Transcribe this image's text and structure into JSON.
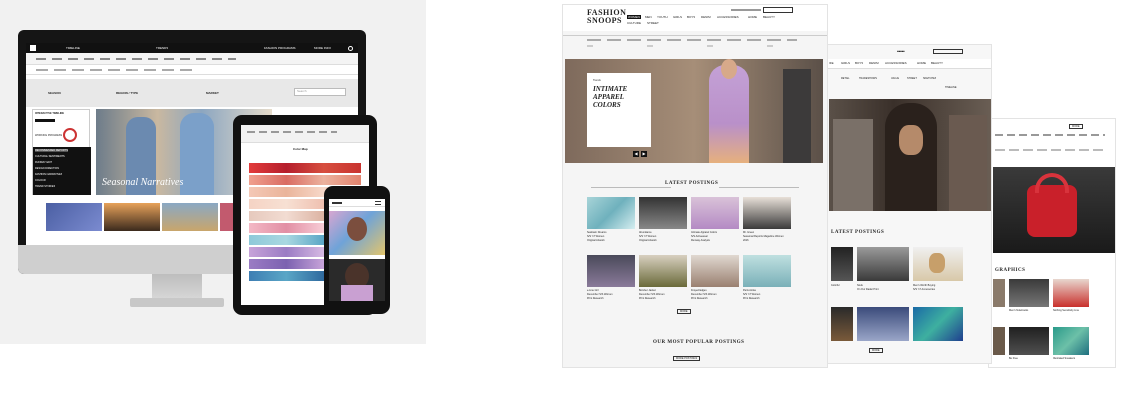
{
  "monitor": {
    "tabs": [
      "TIMELINE",
      "TRENDS"
    ],
    "top_right": [
      "FASHION PROGRAMS",
      "MORE INFO"
    ],
    "filters": [
      "SEASON",
      "REGION / TYPE",
      "MARKET"
    ],
    "search_placeholder": "Search",
    "sidebar": {
      "title": "INTERACTIVE TIMELINE",
      "label": "WORKING PROGRESS",
      "items": [
        "RECOMMENDED REPORTS",
        "CULTURAL SENTIMENTS",
        "RUNWAY EDIT",
        "DESIGN DIRECTION",
        "FASHION NARRATIVES",
        "COLOUR",
        "TREND STORIES"
      ]
    },
    "hero_caption": "Seasonal Narratives"
  },
  "tablet": {
    "title": "Color Map"
  },
  "right": {
    "logo_line1": "FASHION",
    "logo_line2": "SNOOPS",
    "nav": [
      "WOMEN",
      "MEN",
      "YOUTH",
      "GIRLS",
      "BOYS",
      "DENIM",
      "ACCESSORIES",
      "HOME",
      "BEAUTY"
    ],
    "nav_row2": [
      "CULTURE",
      "STREET"
    ],
    "feature": {
      "kicker": "Trends",
      "title": "INTIMATE APPAREL COLORS"
    },
    "latest_postings": "LATEST POSTINGS",
    "postings_row1": [
      {
        "title": "Seafoam Dreams",
        "sub": "S/S '17 Women",
        "type": "Original Artwork"
      },
      {
        "title": "Abundance",
        "sub": "S/S '17 Women",
        "type": "Original Artwork"
      },
      {
        "title": "Intimate Apparel Colors",
        "sub": "S/S Activewear",
        "type": "Runway Analysis"
      },
      {
        "title": "Mr. Green",
        "sub": "Seasonal Reports Magazine Women",
        "type": "2016"
      }
    ],
    "postings_row2": [
      {
        "title": "e-Line Girl",
        "sub": "December S/S Women",
        "type": "Print Research"
      },
      {
        "title": "Bomber Jacket",
        "sub": "December S/S Women",
        "type": "Print Research"
      },
      {
        "title": "Frayed Edges",
        "sub": "December S/S Women",
        "type": "Print Research"
      },
      {
        "title": "Paris Active",
        "sub": "S/S '17 Women",
        "type": "Print Research"
      }
    ],
    "more": "MORE",
    "most_popular": "OUR MOST POPULAR POSTINGS",
    "more_postings": "MORE POSTINGS",
    "page2": {
      "nav": [
        "IFE",
        "GIRLS",
        "BOYS",
        "DENIM",
        "ACCESSORIES",
        "HOME",
        "BEAUTY"
      ],
      "nav2": [
        "RETAIL",
        "TRADESHOWS",
        "VALUE",
        "STREET",
        "SKETCHES"
      ],
      "timeline": "TIMELINE",
      "latest_postings": "LATEST POSTINGS",
      "items": [
        {
          "title": "Colorful",
          "sub": ""
        },
        {
          "title": "Nook",
          "sub": "On Our Radar Print"
        },
        {
          "title": "Men's Worth Buying",
          "sub": "S/S '17 Accessories"
        }
      ],
      "more": "MORE"
    },
    "page3": {
      "btn": "MORE",
      "heading": "GRAPHICS",
      "items": [
        {
          "title": "Men's Notebooks",
          "sub": "S/S '17"
        },
        {
          "title": "Nothing Sensitivity Line",
          "sub": "S/S '17 Accessories"
        },
        {
          "title": "Be Free",
          "sub": "Be Free"
        },
        {
          "title": "Illustrated Sneakers",
          "sub": ""
        }
      ]
    }
  },
  "colors": {
    "black": "#111111",
    "swatch_reds": [
      "#c9332f",
      "#b3243c",
      "#d96c62",
      "#e9a08f",
      "#f2c4b8"
    ],
    "swatch_blues": [
      "#8ec9d9",
      "#5aa6c6",
      "#3e7eb3",
      "#a9d7e1"
    ],
    "swatch_purples": [
      "#9b7cc4",
      "#c7a3d9"
    ]
  }
}
